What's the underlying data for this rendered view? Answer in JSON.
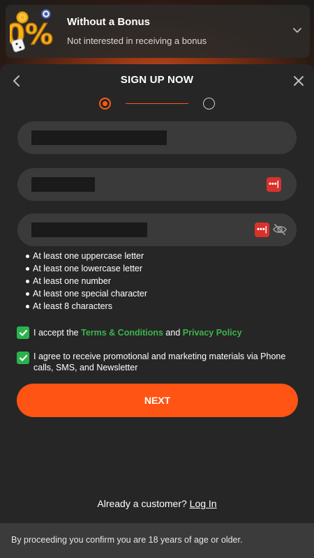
{
  "bonus": {
    "title": "Without a Bonus",
    "subtitle": "Not interested in receiving a bonus",
    "art_text": "0%",
    "icons": [
      "zero-percent-art-icon",
      "chevron-down-icon"
    ]
  },
  "modal": {
    "title": "SIGN UP NOW",
    "steps": {
      "current": 1,
      "total": 2
    },
    "icons": [
      "back-arrow-icon",
      "close-icon"
    ]
  },
  "fields": [
    {
      "name": "email",
      "value": ""
    },
    {
      "name": "phone",
      "value": ""
    },
    {
      "name": "password",
      "value": ""
    }
  ],
  "password_rules": [
    "At least one uppercase letter",
    "At least one lowercase letter",
    "At least one number",
    "At least one special character",
    "At least 8 characters"
  ],
  "consents": {
    "terms_prefix": "I accept the ",
    "terms_link": "Terms & Conditions",
    "terms_and": " and ",
    "privacy_link": "Privacy Policy",
    "marketing": "I agree to receive promotional and marketing materials via Phone calls, SMS, and Newsletter"
  },
  "next_label": "NEXT",
  "login": {
    "prompt": "Already a customer?",
    "link": "Log In"
  },
  "footer": {
    "text": "By proceeding you confirm you are 18 years of age or older."
  },
  "colors": {
    "accent": "#ff5414",
    "check": "#2bb24c",
    "link_green": "#3bb54a",
    "panel": "#262626",
    "field": "#3a3a3a",
    "password_manager": "#d9322c"
  }
}
